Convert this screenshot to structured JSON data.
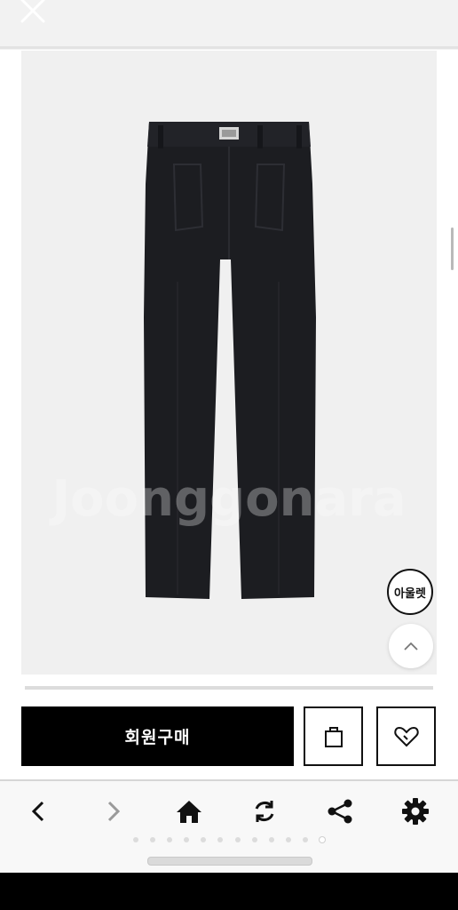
{
  "watermark": "Joonggonara",
  "outlet_badge": "아울렛",
  "buy_button": "회원구매",
  "icons": {
    "close": "close-icon",
    "scroll_top": "chevron-up-icon",
    "cart": "shopping-bag-icon",
    "wishlist": "heart-icon",
    "back": "chevron-left-icon",
    "forward": "chevron-right-icon",
    "home": "home-icon",
    "refresh": "refresh-icon",
    "share": "share-icon",
    "settings": "gear-icon"
  },
  "colors": {
    "primary": "#000000",
    "pants": "#1b1c20"
  }
}
